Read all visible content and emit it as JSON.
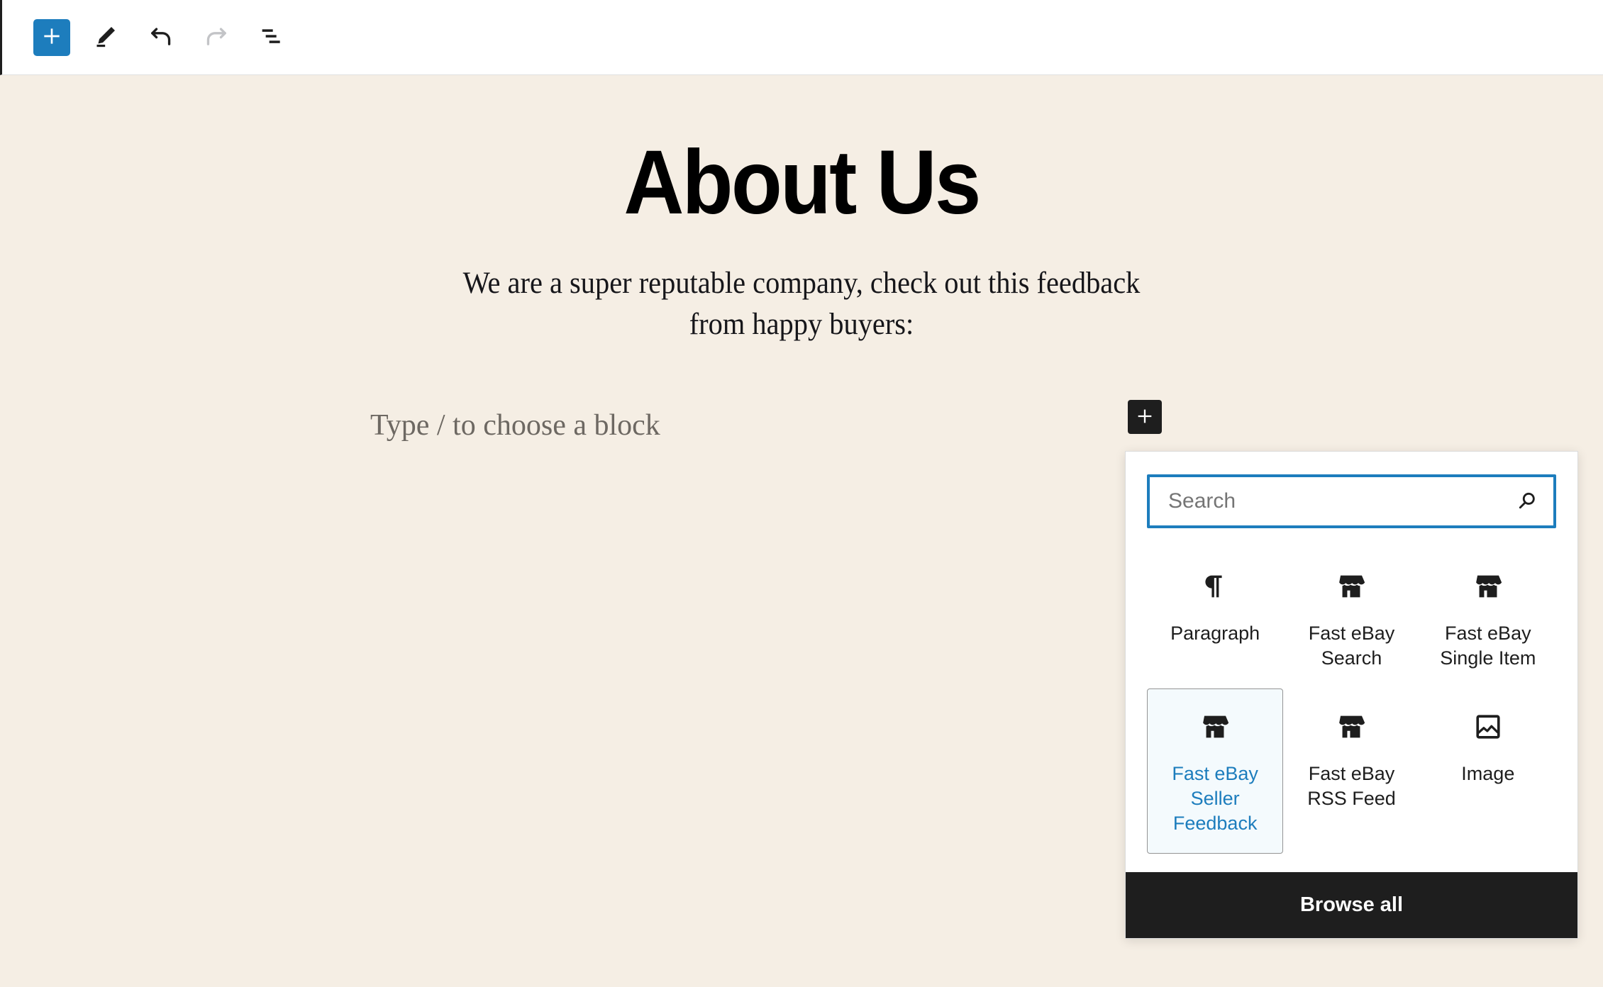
{
  "theme": {
    "canvas_background": "#f5eee4",
    "accent_blue": "#1d7dbd",
    "dark": "#1e1e1e",
    "selected_background": "#f4fafd"
  },
  "toolbar": {
    "add_block_label": "+",
    "items": [
      {
        "name": "add-block-button",
        "icon": "plus-icon",
        "state": "active"
      },
      {
        "name": "tools-button",
        "icon": "pencil-icon",
        "state": "enabled"
      },
      {
        "name": "undo-button",
        "icon": "undo-arrow-icon",
        "state": "enabled"
      },
      {
        "name": "redo-button",
        "icon": "redo-arrow-icon",
        "state": "disabled"
      },
      {
        "name": "list-view-button",
        "icon": "list-view-icon",
        "state": "enabled"
      }
    ]
  },
  "post": {
    "title": "About Us",
    "intro": "We are a super reputable company, check out this feedback from happy buyers:",
    "empty_block_placeholder": "Type / to choose a block"
  },
  "inserter": {
    "toggle_label": "+",
    "search": {
      "placeholder": "Search",
      "value": "",
      "icon": "search-icon"
    },
    "blocks": [
      {
        "label": "Paragraph",
        "icon": "paragraph-icon",
        "selected": false
      },
      {
        "label": "Fast eBay Search",
        "icon": "storefront-icon",
        "selected": false
      },
      {
        "label": "Fast eBay Single Item",
        "icon": "storefront-icon",
        "selected": false
      },
      {
        "label": "Fast eBay Seller Feedback",
        "icon": "storefront-icon",
        "selected": true
      },
      {
        "label": "Fast eBay RSS Feed",
        "icon": "storefront-icon",
        "selected": false
      },
      {
        "label": "Image",
        "icon": "image-icon",
        "selected": false
      }
    ],
    "browse_all_label": "Browse all"
  }
}
